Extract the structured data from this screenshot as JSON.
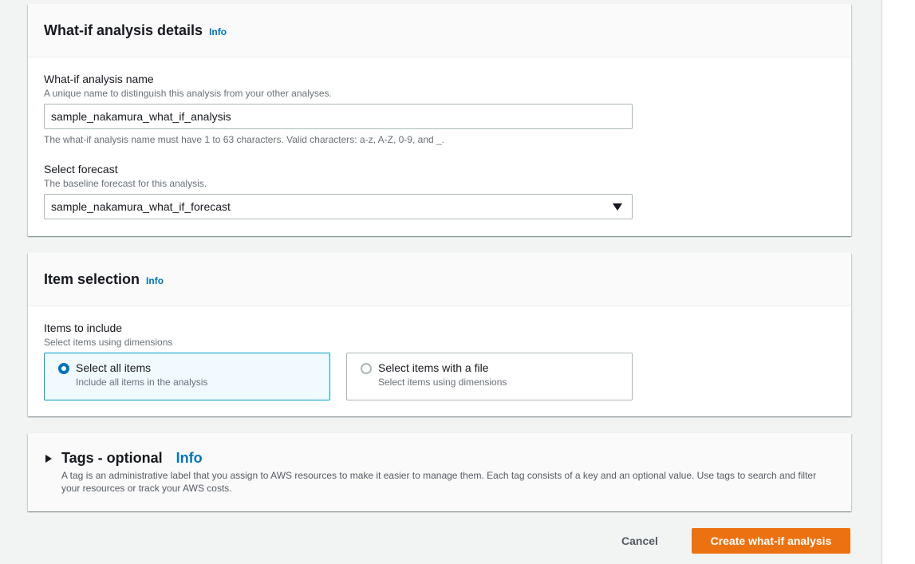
{
  "details": {
    "title": "What-if analysis details",
    "info": "Info",
    "name_label": "What-if analysis name",
    "name_desc": "A unique name to distinguish this analysis from your other analyses.",
    "name_value": "sample_nakamura_what_if_analysis",
    "name_constraint": "The what-if analysis name must have 1 to 63 characters. Valid characters: a-z, A-Z, 0-9, and _.",
    "forecast_label": "Select forecast",
    "forecast_desc": "The baseline forecast for this analysis.",
    "forecast_value": "sample_nakamura_what_if_forecast"
  },
  "items": {
    "title": "Item selection",
    "info": "Info",
    "include_label": "Items to include",
    "include_desc": "Select items using dimensions",
    "options": [
      {
        "title": "Select all items",
        "desc": "Include all items in the analysis",
        "selected": true
      },
      {
        "title": "Select items with a file",
        "desc": "Select items using dimensions",
        "selected": false
      }
    ]
  },
  "tags": {
    "title": "Tags - optional",
    "info": "Info",
    "desc": "A tag is an administrative label that you assign to AWS resources to make it easier to manage them. Each tag consists of a key and an optional value. Use tags to search and filter your resources or track your AWS costs."
  },
  "actions": {
    "cancel": "Cancel",
    "create": "Create what-if analysis"
  },
  "colors": {
    "accent": "#0073bb",
    "primary_button": "#ec7211",
    "selected_tile_border": "#00a1c9"
  }
}
